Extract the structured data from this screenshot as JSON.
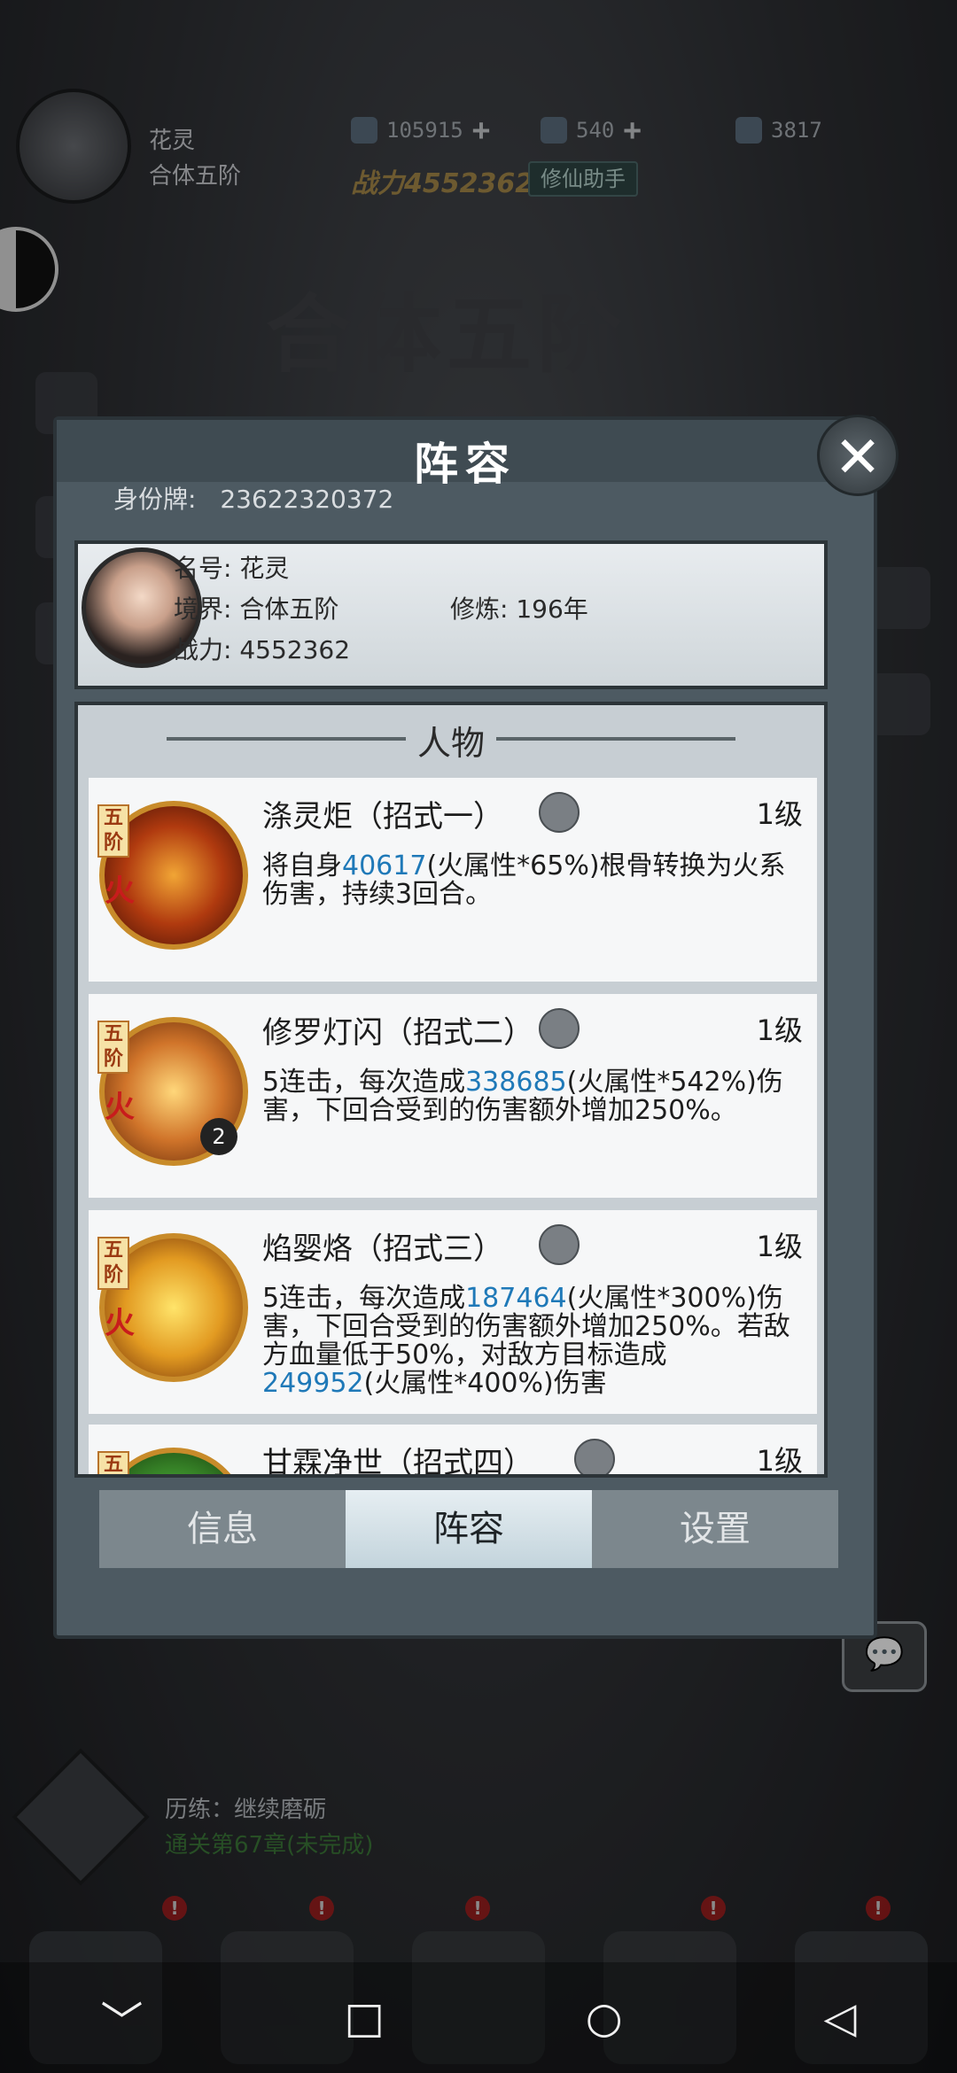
{
  "hud": {
    "player_name": "花灵",
    "player_realm": "合体五阶",
    "currency_1": "105915",
    "currency_2": "540",
    "currency_3": "3817",
    "power_label": "战力4552362",
    "helper_btn": "修仙助手",
    "banner_realm": "合体五阶"
  },
  "panel": {
    "title": "阵容",
    "close_glyph": "✕",
    "id_label": "身份牌:",
    "id_value": "23622320372",
    "name_label": "名号:",
    "name_value": "花灵",
    "realm_label": "境界:",
    "realm_value": "合体五阶",
    "cultivate_label": "修炼:",
    "cultivate_value": "196年",
    "power_label": "战力:",
    "power_value": "4552362",
    "section_title": "人物"
  },
  "skills": [
    {
      "tier": "五阶",
      "element": "火",
      "name": "涤灵炬（招式一）",
      "level": "1级",
      "desc_a": "将自身",
      "val_a": "40617",
      "desc_b": "(火属性*65%)根骨转换为火系伤害，持续3回合。",
      "val_b": "",
      "desc_c": ""
    },
    {
      "tier": "五阶",
      "element": "火",
      "badge": "2",
      "name": "修罗灯闪（招式二）",
      "level": "1级",
      "desc_a": "5连击，每次造成",
      "val_a": "338685",
      "desc_b": "(火属性*542%)伤害，下回合受到的伤害额外增加250%。",
      "val_b": "",
      "desc_c": ""
    },
    {
      "tier": "五阶",
      "element": "火",
      "name": "焰婴烙（招式三）",
      "level": "1级",
      "desc_a": "5连击，每次造成",
      "val_a": "187464",
      "desc_b": "(火属性*300%)伤害，下回合受到的伤害额外增加250%。若敌方血量低于50%，对敌方目标造成",
      "val_b": "249952",
      "desc_c": "(火属性*400%)伤害"
    },
    {
      "tier": "五阶",
      "element": "",
      "name": "甘霖净世（招式四）",
      "level": "1级",
      "desc_a": "",
      "val_a": "",
      "desc_b": "",
      "val_b": "",
      "desc_c": ""
    }
  ],
  "tabs": {
    "info": "信息",
    "lineup": "阵容",
    "settings": "设置"
  },
  "quest": {
    "line1": "历练：继续磨砺",
    "line2": "通关第67章(未完成)"
  },
  "bottom_badge": "!",
  "nav": {
    "down": "﹀",
    "home": "○",
    "square": "□",
    "back": "◁"
  },
  "colors": {
    "highlight": "#1f79b8",
    "fire": "#c81c1c",
    "panel": "#4d5a62"
  }
}
